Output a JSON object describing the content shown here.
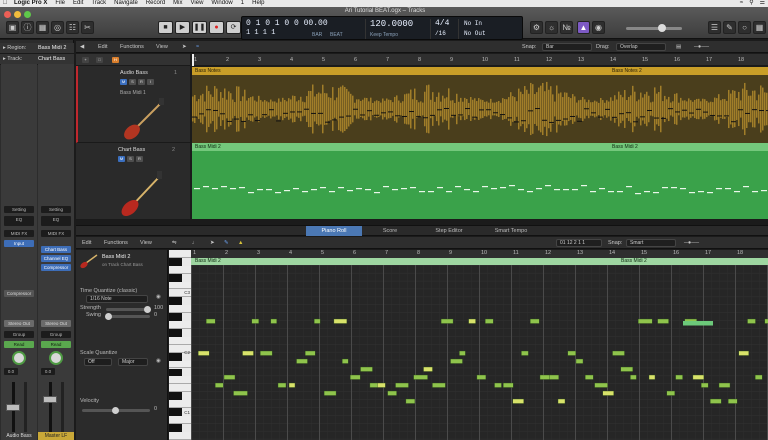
{
  "menubar": {
    "items": [
      "Logic Pro X",
      "File",
      "Edit",
      "Track",
      "Navigate",
      "Record",
      "Mix",
      "View",
      "Window",
      "1",
      "Help"
    ]
  },
  "window": {
    "title": "Ari Tutorial BEAT.ogx – Tracks"
  },
  "lcd": {
    "position": "0 1 0 1 0 0 00.00",
    "bar": "1 1 1 1",
    "bar_label": "BAR",
    "beat_label": "BEAT",
    "tempo": "120.0000",
    "tempo_label": "Keep Tempo",
    "signature": "4/4",
    "division": "/16",
    "key_in": "No In",
    "key_out": "No Out"
  },
  "inspector": {
    "region_label": "Region:",
    "region_value": "Bass Midi 2",
    "track_label": "Track:",
    "track_value": "Chart Bass",
    "left_strip": {
      "setting": "Setting",
      "eq": "EQ",
      "midi_fx": "MIDI FX",
      "input": "Input",
      "plugins": [
        "Compressor",
        "Stereo Out"
      ],
      "group": "Group",
      "read": "Read",
      "pan_value": "0.0",
      "name": "Audio Bass"
    },
    "right_strip": {
      "setting": "Setting",
      "eq": "EQ",
      "midi_fx": "MIDI FX",
      "input": "Chart Bass",
      "plugins": [
        "Channel EQ",
        "Compressor"
      ],
      "output": "Stereo Out",
      "group": "Group",
      "read": "Read",
      "pan_value": "0.0",
      "name": "Master LF"
    }
  },
  "tracks_toolbar": {
    "edit": "Edit",
    "functions": "Functions",
    "view": "View",
    "snap_label": "Snap:",
    "snap_value": "Bar",
    "drag_label": "Drag:",
    "drag_value": "Overlap"
  },
  "tracks": [
    {
      "number": "1",
      "name": "Audio Bass",
      "region_name": "Bass Notes",
      "region_name2": "Bass Notes 2",
      "sub": "Bass Midi 1"
    },
    {
      "number": "2",
      "name": "Chart Bass",
      "region_name": "Bass Midi 2",
      "region_name2": "Bass Midi 2"
    }
  ],
  "ruler_numbers": [
    "1",
    "2",
    "3",
    "4",
    "5",
    "6",
    "7",
    "8",
    "9",
    "10",
    "11",
    "12",
    "13",
    "14",
    "15",
    "16",
    "17",
    "18"
  ],
  "editor_tabs": [
    "Piano Roll",
    "Score",
    "Step Editor",
    "Smart Tempo"
  ],
  "editor_toolbar": {
    "edit": "Edit",
    "functions": "Functions",
    "view": "View",
    "position": "01 12 2 1 1",
    "snap_label": "Snap:",
    "snap_value": "Smart"
  },
  "editor_side": {
    "region_name": "Bass Midi 2",
    "region_sub": "on Track Chart Bass",
    "time_quantize_label": "Time Quantize (classic)",
    "quantize_value": "1/16 Note",
    "strength_label": "Strength",
    "strength_value": "100",
    "swing_label": "Swing",
    "swing_value": "0",
    "scale_quantize_label": "Scale Quantize",
    "scale_off": "Off",
    "scale_type": "Major",
    "velocity_label": "Velocity",
    "velocity_value": "0"
  },
  "piano_labels": [
    "C3",
    "C2",
    "C1"
  ],
  "piano_roll": {
    "region_name": "Bass Midi 2",
    "region_name2": "Bass Midi 2"
  },
  "colors": {
    "audio_region": "#c99e28",
    "midi_region": "#3fa64a",
    "note": "#8fc44c",
    "accent_blue": "#4b78b4"
  }
}
